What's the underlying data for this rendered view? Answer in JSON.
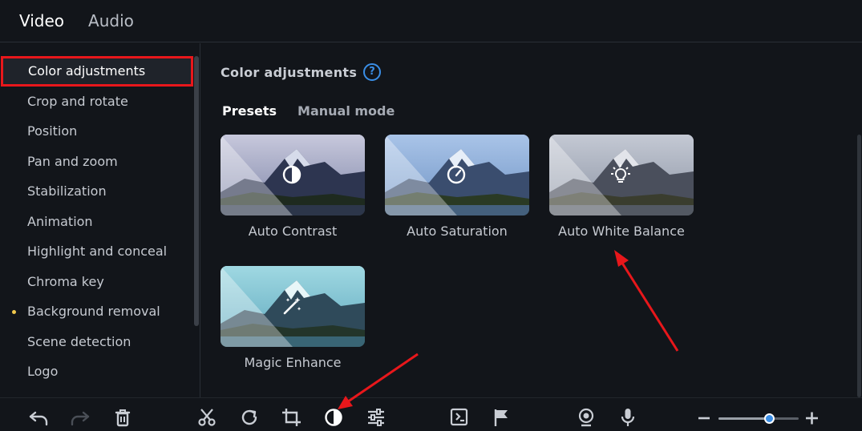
{
  "top_tabs": [
    {
      "label": "Video",
      "active": true
    },
    {
      "label": "Audio",
      "active": false
    }
  ],
  "sidebar": {
    "items": [
      {
        "label": "Color adjustments",
        "selected": true,
        "dot": false
      },
      {
        "label": "Crop and rotate",
        "selected": false,
        "dot": false
      },
      {
        "label": "Position",
        "selected": false,
        "dot": false
      },
      {
        "label": "Pan and zoom",
        "selected": false,
        "dot": false
      },
      {
        "label": "Stabilization",
        "selected": false,
        "dot": false
      },
      {
        "label": "Animation",
        "selected": false,
        "dot": false
      },
      {
        "label": "Highlight and conceal",
        "selected": false,
        "dot": false
      },
      {
        "label": "Chroma key",
        "selected": false,
        "dot": false
      },
      {
        "label": "Background removal",
        "selected": false,
        "dot": true
      },
      {
        "label": "Scene detection",
        "selected": false,
        "dot": false
      },
      {
        "label": "Logo",
        "selected": false,
        "dot": false
      }
    ]
  },
  "main": {
    "title": "Color adjustments",
    "help_glyph": "?",
    "mode_tabs": [
      {
        "label": "Presets",
        "active": true
      },
      {
        "label": "Manual mode",
        "active": false
      }
    ],
    "presets": [
      {
        "label": "Auto Contrast",
        "icon": "contrast-icon"
      },
      {
        "label": "Auto Saturation",
        "icon": "gauge-icon"
      },
      {
        "label": "Auto White Balance",
        "icon": "lightbulb-icon"
      },
      {
        "label": "Magic Enhance",
        "icon": "magic-wand-icon"
      }
    ]
  },
  "toolbar": {
    "icons": [
      "undo-icon",
      "redo-icon",
      "trash-icon",
      "scissors-icon",
      "rotate-icon",
      "crop-icon",
      "color-adjust-icon",
      "sliders-icon",
      "export-frame-icon",
      "flag-icon",
      "webcam-icon",
      "microphone-icon",
      "zoom-out-icon",
      "zoom-in-icon"
    ],
    "zoom_level": 0.63
  },
  "colors": {
    "accent": "#3a8ee6",
    "highlight_box": "#e8171b",
    "annotation_arrow": "#e8171b",
    "background": "#12151a"
  }
}
